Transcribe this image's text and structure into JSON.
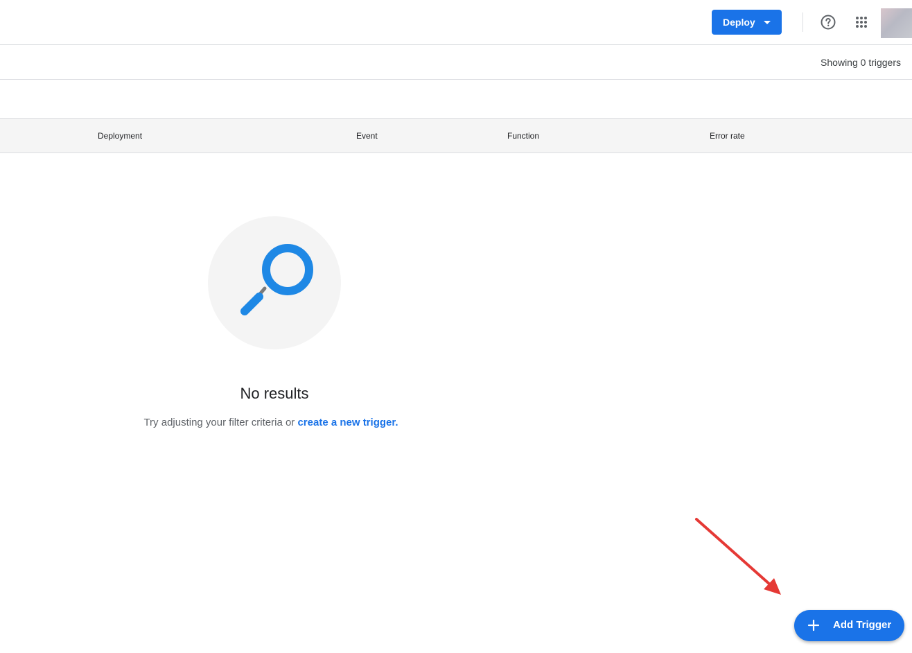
{
  "header": {
    "deploy_label": "Deploy",
    "icons": [
      "help-icon",
      "apps-grid-icon",
      "account-avatar"
    ]
  },
  "toolbar": {
    "showing_text": "Showing 0 triggers"
  },
  "table": {
    "columns": [
      "Deployment",
      "Event",
      "Function",
      "Error rate"
    ]
  },
  "empty_state": {
    "icon": "magnifier-icon",
    "title": "No results",
    "hint_prefix": "Try adjusting your filter criteria or ",
    "hint_link": "create a new trigger."
  },
  "fab": {
    "label": "Add Trigger"
  },
  "annotation": {
    "arrow_color": "#e53935"
  },
  "colors": {
    "accent": "#1a73e8",
    "header_bg": "#f5f5f5",
    "empty_circle": "#f4f4f4",
    "magnifier": "#1e88e5"
  }
}
